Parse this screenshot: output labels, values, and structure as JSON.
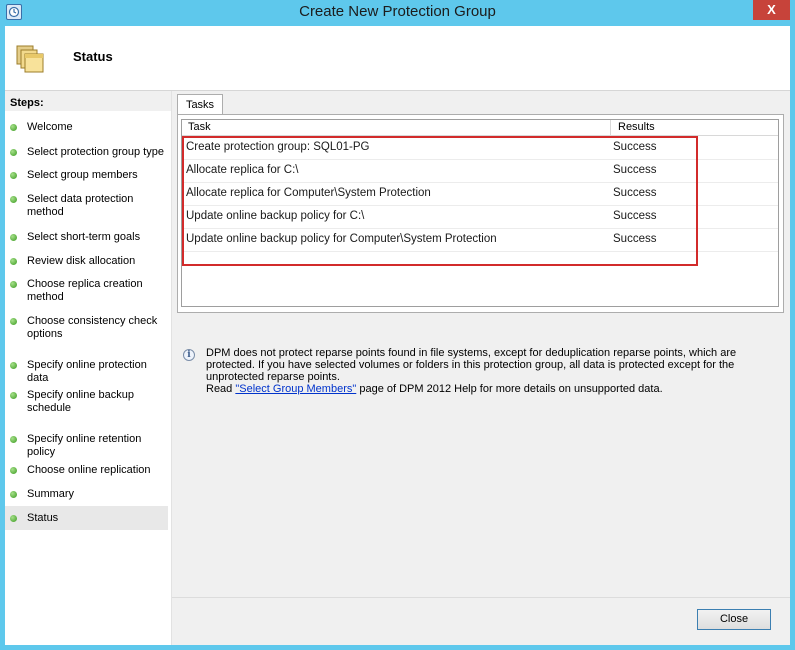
{
  "window": {
    "title": "Create New Protection Group",
    "close_glyph": "X"
  },
  "header": {
    "title": "Status"
  },
  "steps": {
    "title": "Steps:",
    "items": [
      {
        "label": "Welcome"
      },
      {
        "label": "Select protection group type"
      },
      {
        "label": "Select group members"
      },
      {
        "label": "Select data protection method"
      },
      {
        "label": "Select short-term goals"
      },
      {
        "label": "Review disk allocation"
      },
      {
        "label": "Choose replica creation method"
      },
      {
        "label": "Choose consistency check options"
      },
      {
        "label": "Specify online protection data"
      },
      {
        "label": "Specify online backup schedule"
      },
      {
        "label": "Specify online retention policy"
      },
      {
        "label": "Choose online replication"
      },
      {
        "label": "Summary"
      },
      {
        "label": "Status"
      }
    ],
    "active": "Status"
  },
  "tabs": [
    {
      "label": "Tasks"
    }
  ],
  "table": {
    "columns": {
      "task": "Task",
      "results": "Results"
    },
    "rows": [
      {
        "task": "Create protection group: SQL01-PG",
        "result": "Success"
      },
      {
        "task": "Allocate replica for C:\\",
        "result": "Success"
      },
      {
        "task": "Allocate replica for Computer\\System Protection",
        "result": "Success"
      },
      {
        "task": "Update online backup policy for C:\\",
        "result": "Success"
      },
      {
        "task": "Update online backup policy for Computer\\System Protection",
        "result": "Success"
      }
    ]
  },
  "info": {
    "line1": "DPM does not protect reparse points found in file systems, except for deduplication reparse points, which are",
    "line2": "protected. If you have selected volumes or folders in this protection group, all data is protected except for the",
    "line3": "unprotected reparse points.",
    "read_prefix": "Read ",
    "link_text": "\"Select Group Members\"",
    "read_suffix": " page of DPM 2012 Help for more details on unsupported data."
  },
  "buttons": {
    "close": "Close"
  },
  "colors": {
    "titlebar": "#5ec8ec",
    "highlight": "#d22b2b",
    "link": "#0033cc",
    "step_dot": "#3a9a20"
  },
  "icons": {
    "app": "dpm-clock-icon",
    "header": "folder-stack-icon",
    "info": "info-icon"
  }
}
